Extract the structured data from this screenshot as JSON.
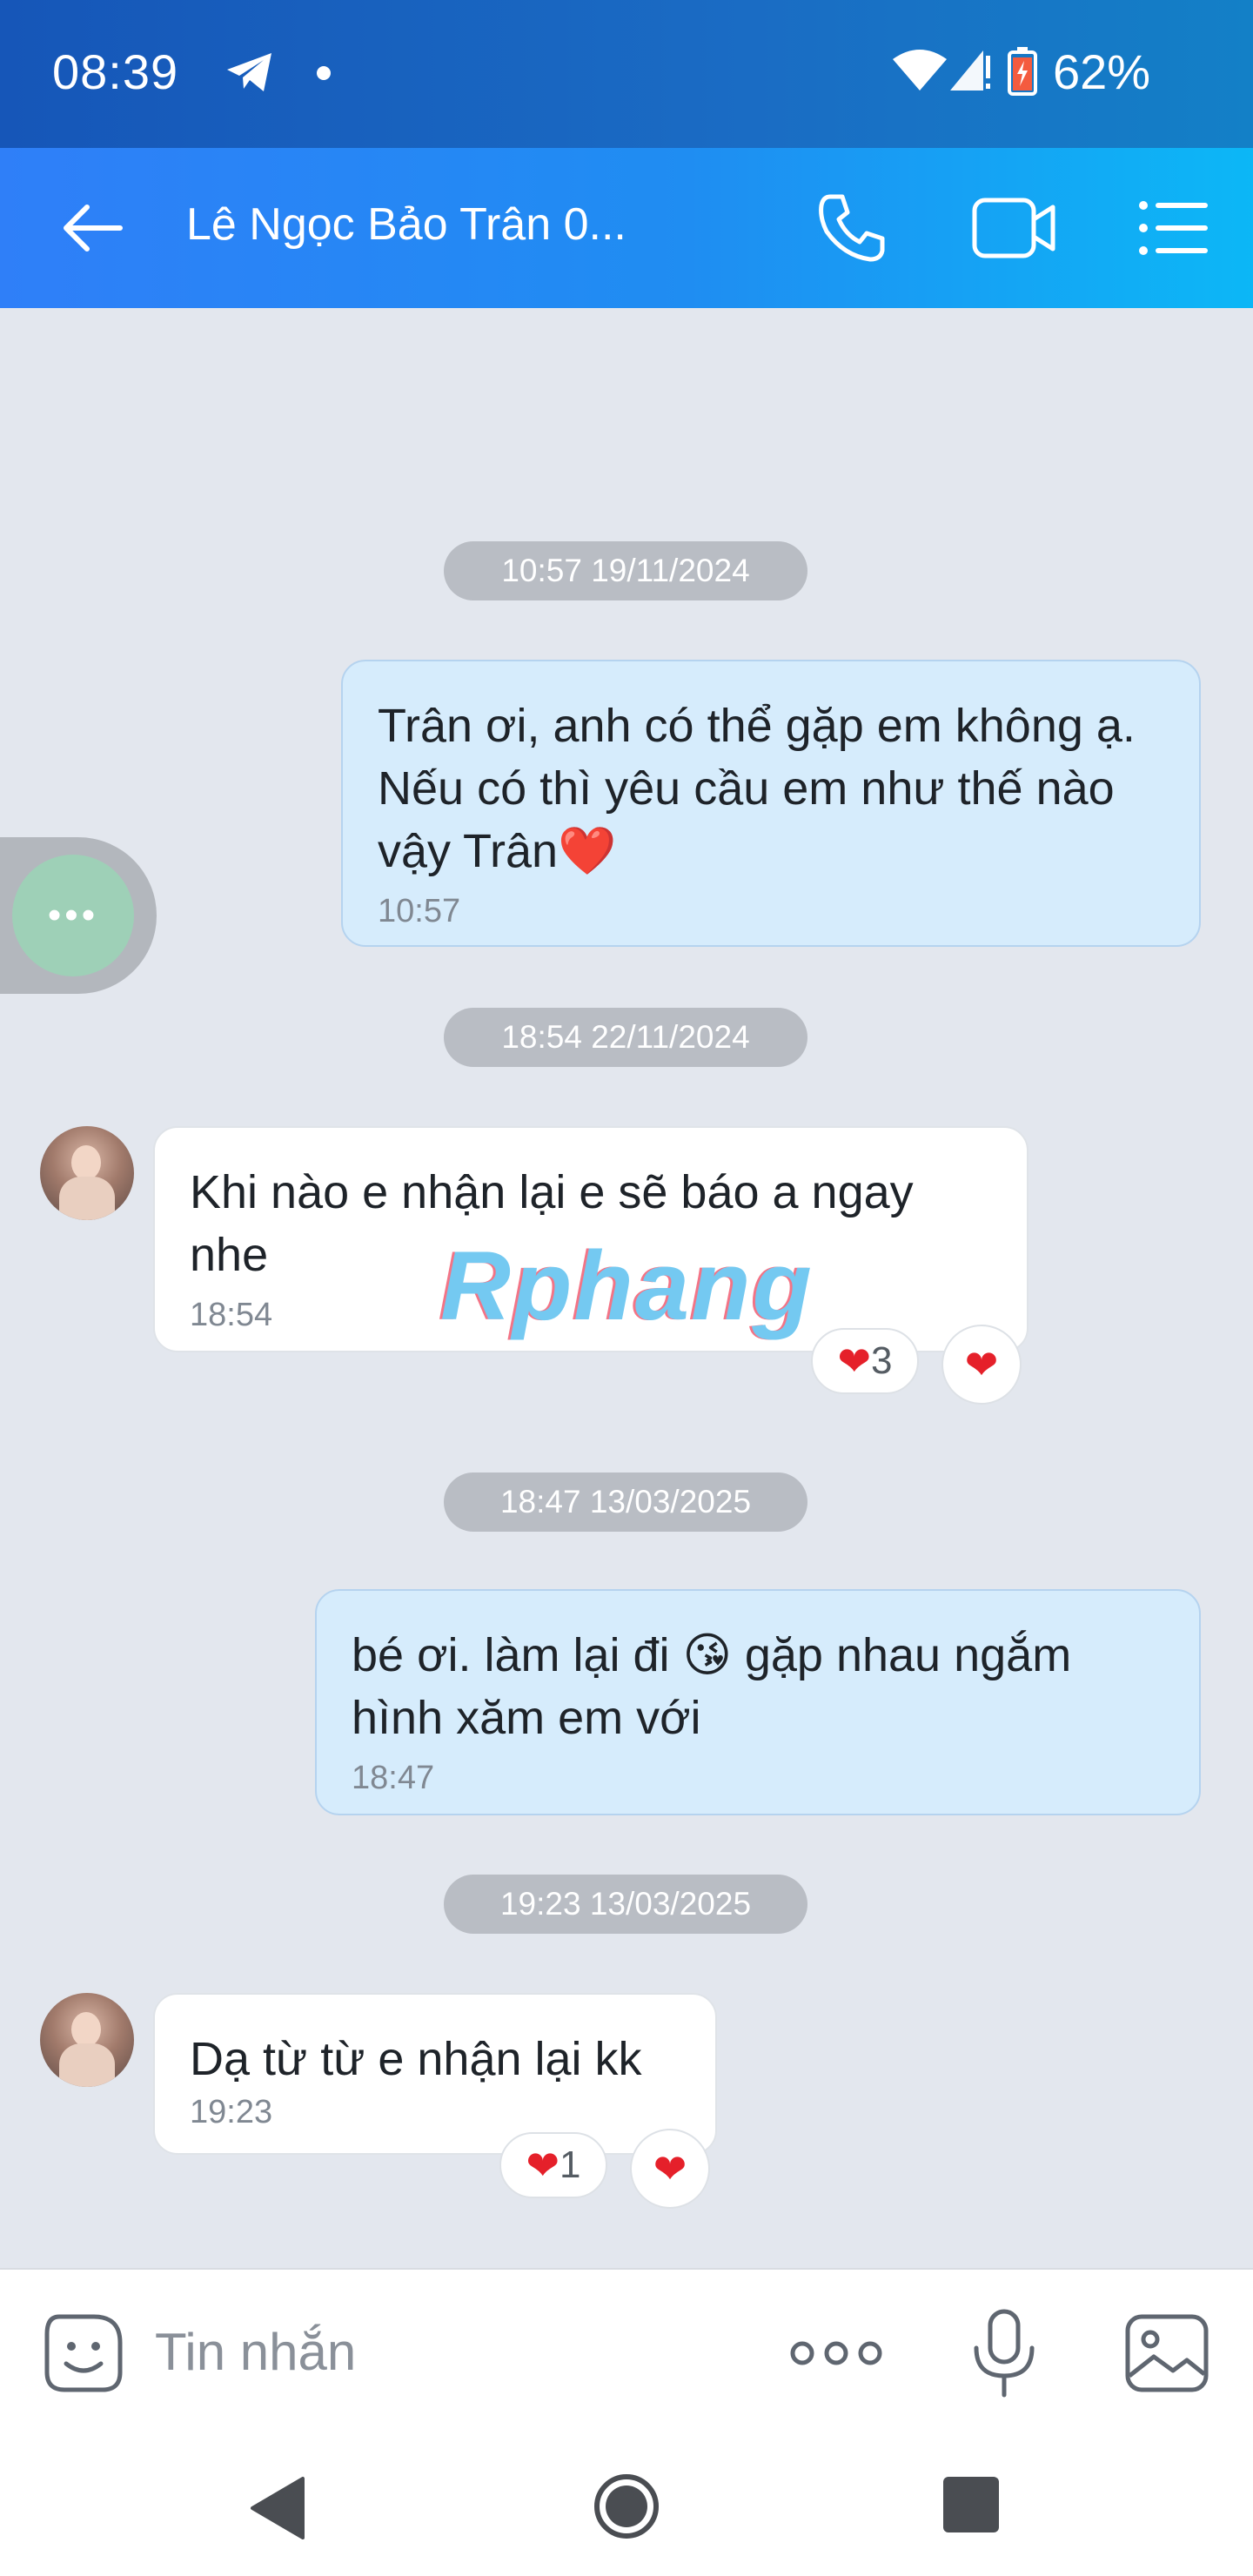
{
  "status_bar": {
    "time": "08:39",
    "battery_percent": "62%",
    "icons": [
      "telegram-icon",
      "notification-dot",
      "wifi-icon",
      "signal-icon",
      "battery-icon"
    ]
  },
  "header": {
    "title": "Lê Ngọc Bảo Trân 0...",
    "icons": [
      "back-arrow-icon",
      "phone-icon",
      "video-call-icon",
      "menu-list-icon"
    ]
  },
  "chat": {
    "timestamps": [
      "10:57 19/11/2024",
      "18:54 22/11/2024",
      "18:47 13/03/2025",
      "19:23 13/03/2025"
    ],
    "messages": [
      {
        "direction": "outgoing",
        "text": "Trân ơi, anh có thể gặp em không ạ. Nếu có thì yêu cầu em như thế nào vậy Trân",
        "emoji": "❤️",
        "time": "10:57"
      },
      {
        "direction": "incoming",
        "text": "Khi nào e nhận lại e sẽ báo a ngay nhe",
        "time": "18:54",
        "reaction_count": "3"
      },
      {
        "direction": "outgoing",
        "text_before_emoji": "bé ơi. làm lại đi ",
        "emoji": "😘",
        "text_after_emoji": " gặp nhau ngắm hình xăm em với",
        "time": "18:47"
      },
      {
        "direction": "incoming",
        "text": "Dạ từ từ e nhận lại kk",
        "time": "19:23",
        "reaction_count": "1"
      }
    ],
    "watermark": "Rphang",
    "float_button_label": "•••"
  },
  "input": {
    "placeholder": "Tin nhắn",
    "icons": [
      "emoji-sticker-icon",
      "more-options-icon",
      "microphone-icon",
      "image-gallery-icon"
    ]
  },
  "colors": {
    "header_start": "#2f7ff8",
    "header_end": "#0cb7f6",
    "outgoing_bubble": "#d6ecfc",
    "incoming_bubble": "#ffffff",
    "chat_background": "#e3e7ee",
    "heart": "#e5202a"
  }
}
